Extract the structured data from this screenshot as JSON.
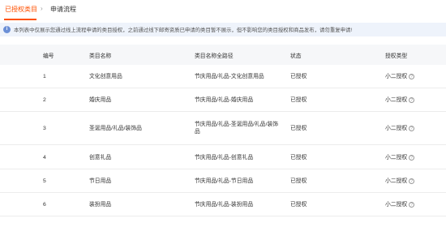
{
  "tabs": {
    "active": "已授权类目",
    "separator": "›",
    "other": "申请流程"
  },
  "notice": {
    "text": "本列表中仅展示您通过线上流程申请的类目授权，之前通过线下邮寄资质已申请的类目暂不展示，但不影响您的类目授权和商品发布，请勿重复申请!"
  },
  "table": {
    "headers": [
      "编号",
      "类目名称",
      "类目名称全路径",
      "状态",
      "授权类型"
    ],
    "rows": [
      {
        "num": "1",
        "category": "文化创意用品",
        "path": "节庆用品/礼品-文化创意用品",
        "status": "已授权",
        "type": "小二授权"
      },
      {
        "num": "2",
        "category": "婚庆用品",
        "path": "节庆用品/礼品-婚庆用品",
        "status": "已授权",
        "type": "小二授权"
      },
      {
        "num": "3",
        "category": "圣诞用品/礼品/装饰品",
        "path": "节庆用品/礼品-圣诞用品/礼品/装饰品",
        "status": "已授权",
        "type": "小二授权"
      },
      {
        "num": "4",
        "category": "创意礼品",
        "path": "节庆用品/礼品-创意礼品",
        "status": "已授权",
        "type": "小二授权"
      },
      {
        "num": "5",
        "category": "节日用品",
        "path": "节庆用品/礼品-节日用品",
        "status": "已授权",
        "type": "小二授权"
      },
      {
        "num": "6",
        "category": "装扮用品",
        "path": "节庆用品/礼品-装扮用品",
        "status": "已授权",
        "type": "小二授权"
      }
    ]
  },
  "colors": {
    "accent": "#ff5000",
    "notice_bg": "#eef3fb",
    "header_bg": "#f6f7f9"
  },
  "icons": {
    "notice": "info-icon",
    "type_help": "question-circle-icon"
  }
}
